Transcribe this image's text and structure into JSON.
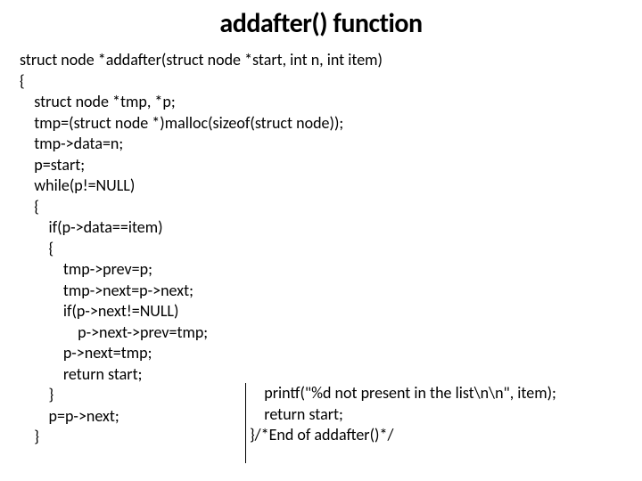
{
  "title": "addafter() function",
  "code_left": "struct node *addafter(struct node *start, int n, int item)\n{\n    struct node *tmp, *p;\n    tmp=(struct node *)malloc(sizeof(struct node));\n    tmp->data=n;\n    p=start;\n    while(p!=NULL)\n    {\n        if(p->data==item)\n        {\n            tmp->prev=p;\n            tmp->next=p->next;\n            if(p->next!=NULL)\n                p->next->prev=tmp;\n            p->next=tmp;\n            return start;\n        }\n        p=p->next;\n    }",
  "code_right": "    printf(\"%d not present in the list\\n\\n\", item);\n    return start;\n}/*End of addafter()*/"
}
